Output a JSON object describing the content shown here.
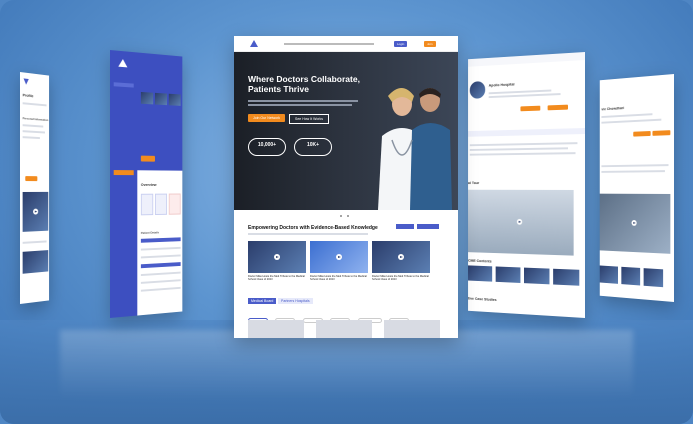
{
  "hero": {
    "title": "Where Doctors Collaborate, Patients Thrive",
    "cta_primary": "Join Our Network",
    "cta_secondary": "See How It Works",
    "stat1_value": "10,000+",
    "stat2_value": "10K+"
  },
  "nav": {
    "btn1": "Login",
    "btn2": "Join"
  },
  "section": {
    "title": "Empowering Doctors with Evidence-Based Knowledge",
    "tab1": "Medical Board",
    "tab2": "Partners Hospitals"
  },
  "videos": [
    "Doctor Mike Hosts the Mett Tribute to the Medical School Class of 2023",
    "Doctor Mike Hosts the Mett Tribute to the Medical School Class of 2023",
    "Doctor Mike Hosts the Mett Tribute to the Medical School Class of 2023"
  ],
  "profile": {
    "title": "Profile",
    "section": "Personal Information"
  },
  "dashboard": {
    "overview": "Overview",
    "patient_details": "Patient Details",
    "btn": "Get Started"
  },
  "hospital": {
    "name": "Apollo Hospital",
    "tour": "al Tour",
    "cme": "CME Contents",
    "case": "tive Case Studies"
  },
  "right": {
    "name": "vic Chowdhari"
  },
  "colors": {
    "accent": "#f28b1e",
    "brand": "#4a5cc9",
    "bg": "#4f86c4"
  }
}
